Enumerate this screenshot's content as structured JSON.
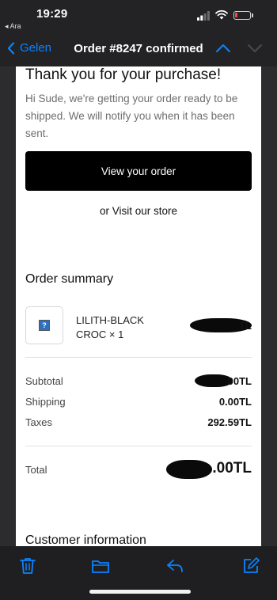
{
  "status_bar": {
    "time": "19:29",
    "back_app_label": "◂ Ara",
    "battery_level": 0.18,
    "battery_color": "#ff453a"
  },
  "nav": {
    "back_label": "Gelen",
    "title": "Order #8247 confirmed",
    "accent_color": "#0a84ff"
  },
  "email": {
    "heading": "Thank you for your purchase!",
    "intro": "Hi Sude, we're getting your order ready to be shipped. We will notify you when it has been sent.",
    "view_order_label": "View your order",
    "visit_store_text": "or Visit our store",
    "summary_title": "Order summary",
    "item": {
      "name": "LILITH-BLACK CROC × 1",
      "price_visible": "TL",
      "thumbnail_icon": "broken-image-icon"
    },
    "rows": [
      {
        "label": "Subtotal",
        "value_visible": "00TL"
      },
      {
        "label": "Shipping",
        "value": "0.00TL"
      },
      {
        "label": "Taxes",
        "value": "292.59TL"
      }
    ],
    "total": {
      "label": "Total",
      "value_visible": ".00TL"
    },
    "customer_info_title": "Customer information"
  },
  "toolbar": {
    "icons": [
      "trash-icon",
      "folder-icon",
      "reply-icon",
      "compose-icon"
    ]
  }
}
